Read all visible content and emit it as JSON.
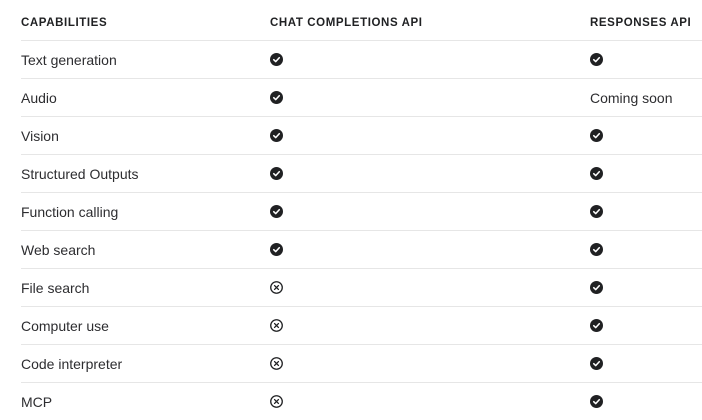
{
  "headers": {
    "capabilities": "CAPABILITIES",
    "chat": "CHAT COMPLETIONS API",
    "responses": "RESPONSES API"
  },
  "rows": [
    {
      "name": "Text generation",
      "chat": "check",
      "responses": "check"
    },
    {
      "name": "Audio",
      "chat": "check",
      "responses": "Coming soon"
    },
    {
      "name": "Vision",
      "chat": "check",
      "responses": "check"
    },
    {
      "name": "Structured Outputs",
      "chat": "check",
      "responses": "check"
    },
    {
      "name": "Function calling",
      "chat": "check",
      "responses": "check"
    },
    {
      "name": "Web search",
      "chat": "check",
      "responses": "check"
    },
    {
      "name": "File search",
      "chat": "cross",
      "responses": "check"
    },
    {
      "name": "Computer use",
      "chat": "cross",
      "responses": "check"
    },
    {
      "name": "Code interpreter",
      "chat": "cross",
      "responses": "check"
    },
    {
      "name": "MCP",
      "chat": "cross",
      "responses": "check"
    }
  ],
  "icons": {
    "check": "check-circle-icon",
    "cross": "x-circle-icon"
  },
  "colors": {
    "icon_fill": "#202123",
    "divider": "#e6e6e6",
    "text": "#2d2d30"
  }
}
